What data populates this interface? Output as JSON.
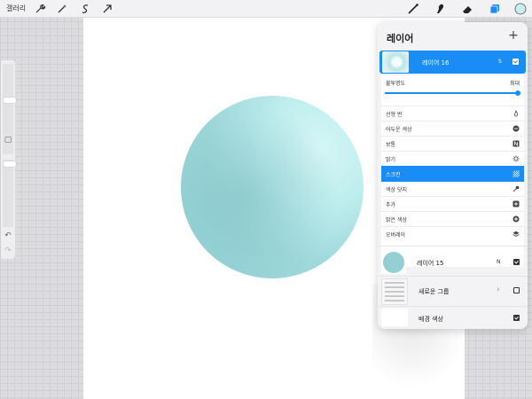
{
  "topbar": {
    "gallery_label": "갤러리"
  },
  "layers_panel": {
    "title": "레이어",
    "add_symbol": "+",
    "active_layer": {
      "name": "레이어 16",
      "blend_abbrev": "S"
    },
    "opacity": {
      "label": "불투명도",
      "value_label": "최대",
      "value": 1.0
    },
    "blend_modes": [
      {
        "label": "선형 번",
        "icon": "flame-icon"
      },
      {
        "label": "어두운 색상",
        "icon": "minus-circle-icon"
      },
      {
        "label": "보통",
        "icon": "n-square-icon"
      },
      {
        "label": "밝기",
        "icon": "sun-icon"
      },
      {
        "label": "스크린",
        "icon": "hatch-icon",
        "selected": true
      },
      {
        "label": "색상 닷지",
        "icon": "dropper-icon"
      },
      {
        "label": "추가",
        "icon": "plus-square-icon"
      },
      {
        "label": "밝은 색상",
        "icon": "plus-circle-icon"
      },
      {
        "label": "오버레이",
        "icon": "layers-icon"
      }
    ],
    "layers": [
      {
        "name": "레이어 15",
        "blend_abbrev": "N",
        "visible": true
      },
      {
        "name": "새로운 그룹",
        "blend_abbrev": "",
        "visible": false,
        "is_group": true
      },
      {
        "name": "배경 색상",
        "blend_abbrev": "",
        "visible": true
      }
    ]
  },
  "colors": {
    "accent": "#1a8cf5",
    "circle_light": "#c8f2f2",
    "circle_dark": "#8cc9cd"
  }
}
